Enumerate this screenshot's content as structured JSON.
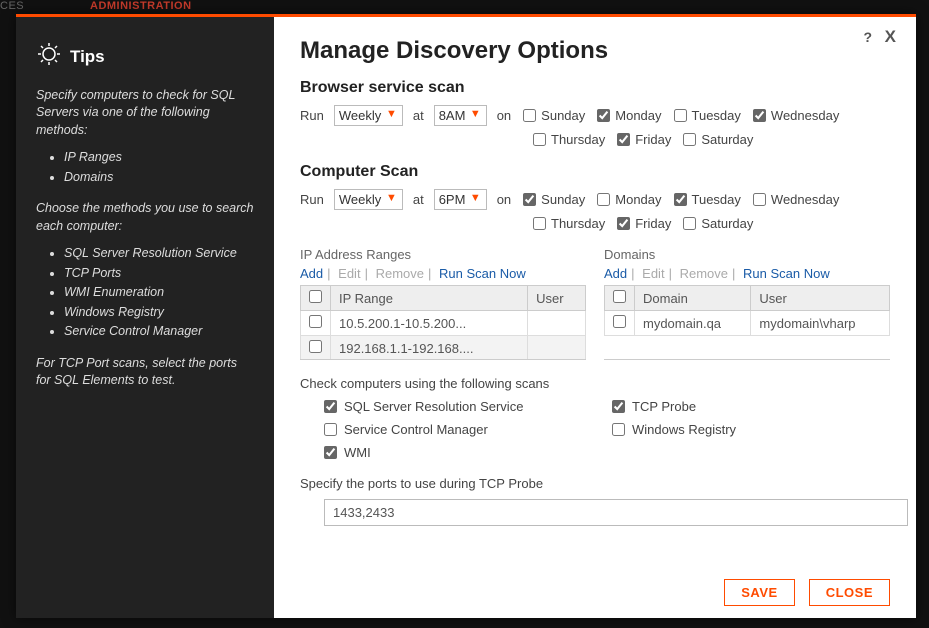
{
  "bg": {
    "ces": "CES",
    "admin": "ADMINISTRATION"
  },
  "tips": {
    "title": "Tips",
    "para1": "Specify computers to check for SQL Servers via one of the following methods:",
    "methods": [
      "IP Ranges",
      "Domains"
    ],
    "para2": "Choose the methods you use to search each computer:",
    "search_methods": [
      "SQL Server Resolution Service",
      "TCP Ports",
      "WMI Enumeration",
      "Windows Registry",
      "Service Control Manager"
    ],
    "para3": "For TCP Port scans, select the ports for SQL Elements to test."
  },
  "dialog": {
    "title": "Manage Discovery Options",
    "help": "?",
    "close": "X"
  },
  "browser_scan": {
    "heading": "Browser service scan",
    "run_label": "Run",
    "freq": "Weekly",
    "at_label": "at",
    "time": "8AM",
    "on_label": "on",
    "days": [
      {
        "name": "Sunday",
        "checked": false
      },
      {
        "name": "Monday",
        "checked": true
      },
      {
        "name": "Tuesday",
        "checked": false
      },
      {
        "name": "Wednesday",
        "checked": true
      },
      {
        "name": "Thursday",
        "checked": false
      },
      {
        "name": "Friday",
        "checked": true
      },
      {
        "name": "Saturday",
        "checked": false
      }
    ]
  },
  "computer_scan": {
    "heading": "Computer Scan",
    "run_label": "Run",
    "freq": "Weekly",
    "at_label": "at",
    "time": "6PM",
    "on_label": "on",
    "days": [
      {
        "name": "Sunday",
        "checked": true
      },
      {
        "name": "Monday",
        "checked": false
      },
      {
        "name": "Tuesday",
        "checked": true
      },
      {
        "name": "Wednesday",
        "checked": false
      },
      {
        "name": "Thursday",
        "checked": false
      },
      {
        "name": "Friday",
        "checked": true
      },
      {
        "name": "Saturday",
        "checked": false
      }
    ]
  },
  "ip_ranges": {
    "title": "IP Address Ranges",
    "links": {
      "add": "Add",
      "edit": "Edit",
      "remove": "Remove",
      "run": "Run Scan Now"
    },
    "cols": {
      "range": "IP Range",
      "user": "User"
    },
    "rows": [
      {
        "range": "10.5.200.1-10.5.200...",
        "user": ""
      },
      {
        "range": "192.168.1.1-192.168....",
        "user": ""
      }
    ]
  },
  "domains": {
    "title": "Domains",
    "links": {
      "add": "Add",
      "edit": "Edit",
      "remove": "Remove",
      "run": "Run Scan Now"
    },
    "cols": {
      "domain": "Domain",
      "user": "User"
    },
    "rows": [
      {
        "domain": "mydomain.qa",
        "user": "mydomain\\vharp"
      }
    ]
  },
  "scans": {
    "label": "Check computers using the following scans",
    "items": [
      {
        "name": "SQL Server Resolution Service",
        "checked": true
      },
      {
        "name": "TCP Probe",
        "checked": true
      },
      {
        "name": "Service Control Manager",
        "checked": false
      },
      {
        "name": "Windows Registry",
        "checked": false
      },
      {
        "name": "WMI",
        "checked": true
      }
    ]
  },
  "ports": {
    "label": "Specify the ports to use during TCP Probe",
    "value": "1433,2433"
  },
  "buttons": {
    "save": "SAVE",
    "close": "CLOSE"
  }
}
